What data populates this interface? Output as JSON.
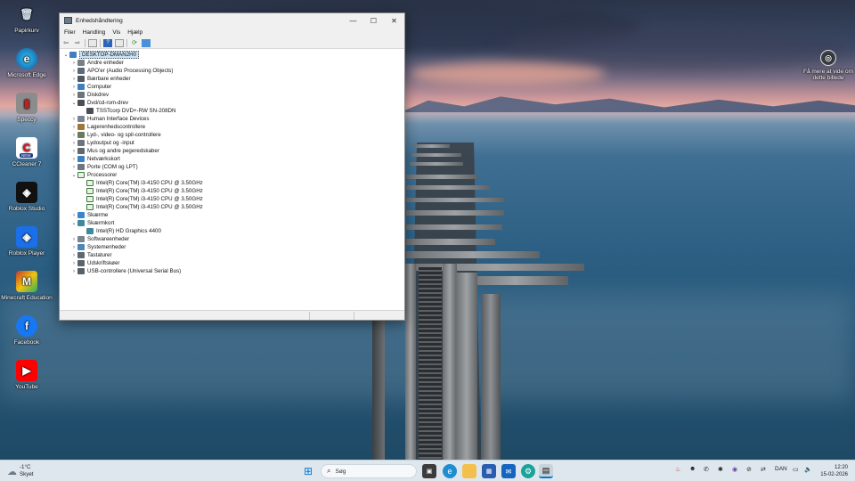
{
  "desktop": {
    "icons": [
      {
        "label": "Papirkurv",
        "icon": "recycle-bin-icon"
      },
      {
        "label": "Microsoft Edge",
        "icon": "edge-icon"
      },
      {
        "label": "Speccy",
        "icon": "speccy-icon"
      },
      {
        "label": "CCleaner 7",
        "icon": "ccleaner-icon",
        "badge": "NEW"
      },
      {
        "label": "Roblox Studio",
        "icon": "roblox-studio-icon"
      },
      {
        "label": "Roblox Player",
        "icon": "roblox-player-icon"
      },
      {
        "label": "Minecraft Education",
        "icon": "minecraft-education-icon"
      },
      {
        "label": "Facebook",
        "icon": "facebook-icon"
      },
      {
        "label": "YouTube",
        "icon": "youtube-icon"
      }
    ],
    "spotlight": {
      "label": "Få mere at vide om dette billede",
      "icon": "camera-icon"
    }
  },
  "window": {
    "title": "Enhedshåndtering",
    "controls": {
      "minimize": "—",
      "maximize": "☐",
      "close": "✕"
    },
    "menu": [
      "Filer",
      "Handling",
      "Vis",
      "Hjælp"
    ],
    "toolbar_icons": [
      "back-icon",
      "forward-icon",
      "properties-icon",
      "show-hidden-icon",
      "help-icon",
      "view-icon",
      "scan-hardware-icon",
      "monitor-icon"
    ],
    "tree": {
      "root": "DESKTOP-DMAN2H0",
      "nodes": [
        {
          "label": "Andre enheder",
          "expanded": false,
          "icon": "unknown-device-icon",
          "children": []
        },
        {
          "label": "APO'er (Audio Processing Objects)",
          "expanded": false,
          "icon": "audio-icon",
          "children": []
        },
        {
          "label": "Bærbare enheder",
          "expanded": false,
          "icon": "portable-device-icon",
          "children": []
        },
        {
          "label": "Computer",
          "expanded": false,
          "icon": "computer-icon",
          "children": []
        },
        {
          "label": "Diskdrev",
          "expanded": false,
          "icon": "disk-icon",
          "children": []
        },
        {
          "label": "Dvd/cd-rom-drev",
          "expanded": true,
          "icon": "dvd-icon",
          "children": [
            "TSSTcorp DVD+-RW SN-208DN"
          ]
        },
        {
          "label": "Human Interface Devices",
          "expanded": false,
          "icon": "hid-icon",
          "children": []
        },
        {
          "label": "Lagerenhedscontrollere",
          "expanded": false,
          "icon": "storage-controller-icon",
          "children": []
        },
        {
          "label": "Lyd-, video- og spil-controllere",
          "expanded": false,
          "icon": "sound-icon",
          "children": []
        },
        {
          "label": "Lydoutput og -input",
          "expanded": false,
          "icon": "speaker-icon",
          "children": []
        },
        {
          "label": "Mus og andre pegeredskaber",
          "expanded": false,
          "icon": "mouse-icon",
          "children": []
        },
        {
          "label": "Netværkskort",
          "expanded": false,
          "icon": "network-icon",
          "children": []
        },
        {
          "label": "Porte (COM og LPT)",
          "expanded": false,
          "icon": "port-icon",
          "children": []
        },
        {
          "label": "Processorer",
          "expanded": true,
          "icon": "cpu-icon",
          "children": [
            "Intel(R) Core(TM) i3-4150 CPU @ 3.50GHz",
            "Intel(R) Core(TM) i3-4150 CPU @ 3.50GHz",
            "Intel(R) Core(TM) i3-4150 CPU @ 3.50GHz",
            "Intel(R) Core(TM) i3-4150 CPU @ 3.50GHz"
          ]
        },
        {
          "label": "Skærme",
          "expanded": false,
          "icon": "monitor-icon",
          "children": []
        },
        {
          "label": "Skærmkort",
          "expanded": true,
          "icon": "display-adapter-icon",
          "children": [
            "Intel(R) HD Graphics 4400"
          ]
        },
        {
          "label": "Softwareenheder",
          "expanded": false,
          "icon": "software-device-icon",
          "children": []
        },
        {
          "label": "Systemenheder",
          "expanded": false,
          "icon": "system-device-icon",
          "children": []
        },
        {
          "label": "Tastaturer",
          "expanded": false,
          "icon": "keyboard-icon",
          "children": []
        },
        {
          "label": "Udskriftskøer",
          "expanded": false,
          "icon": "printer-icon",
          "children": []
        },
        {
          "label": "USB-controllere (Universal Serial Bus)",
          "expanded": false,
          "icon": "usb-icon",
          "children": []
        }
      ]
    }
  },
  "taskbar": {
    "weather": {
      "temp": "-1°C",
      "condition": "Skyet"
    },
    "search_placeholder": "Søg",
    "language": "DAN",
    "time": "12:20",
    "date": "15-02-2026"
  },
  "colors": {
    "accent": "#0078d4",
    "selection": "#cce4f7"
  }
}
